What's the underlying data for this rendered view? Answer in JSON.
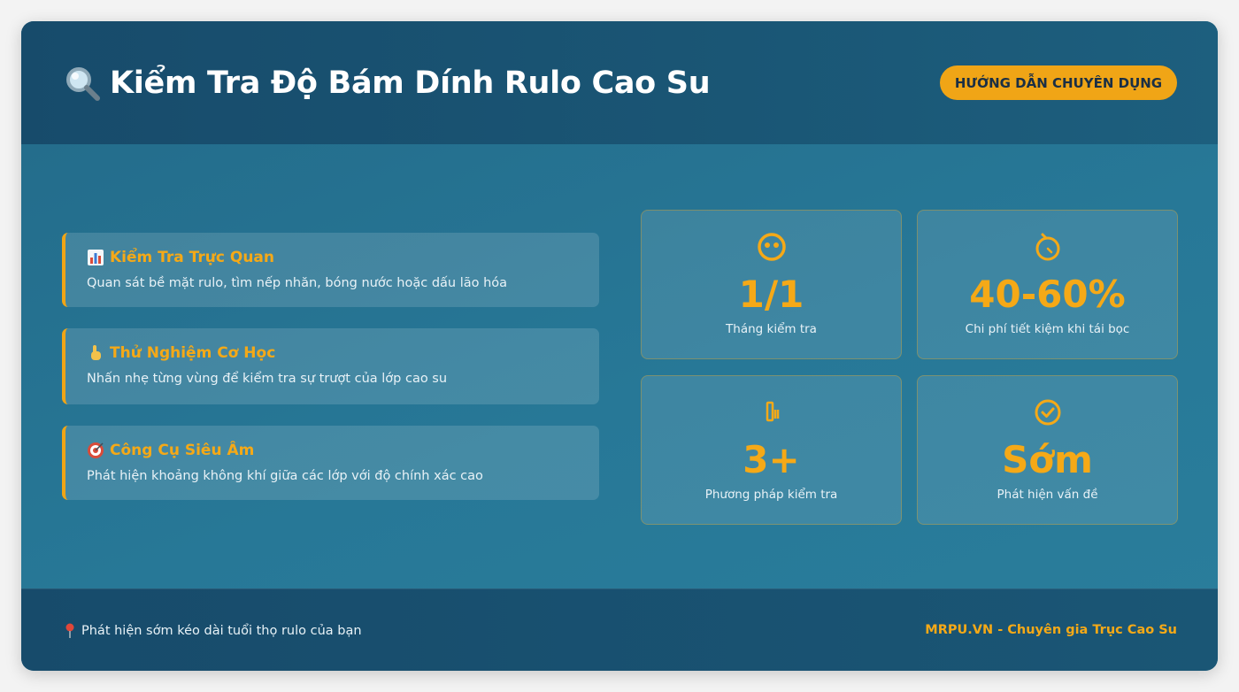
{
  "header": {
    "title": "Kiểm Tra Độ Bám Dính Rulo Cao Su",
    "title_icon": "magnifier-icon",
    "badge": "HƯỚNG DẪN CHUYÊN DỤNG"
  },
  "methods": [
    {
      "icon": "bar-chart-icon",
      "title": "Kiểm Tra Trực Quan",
      "desc": "Quan sát bề mặt rulo, tìm nếp nhăn, bóng nước hoặc dấu lão hóa"
    },
    {
      "icon": "pointing-hand-icon",
      "title": "Thử Nghiệm Cơ Học",
      "desc": "Nhấn nhẹ từng vùng để kiểm tra sự trượt của lớp cao su"
    },
    {
      "icon": "target-icon",
      "title": "Công Cụ Siêu Âm",
      "desc": "Phát hiện khoảng không khí giữa các lớp với độ chính xác cao"
    }
  ],
  "stats": [
    {
      "icon": "face-icon",
      "value": "1/1",
      "label": "Tháng kiểm tra"
    },
    {
      "icon": "stopwatch-icon",
      "value": "40-60%",
      "label": "Chi phí tiết kiệm khi tái bọc"
    },
    {
      "icon": "tool-icon",
      "value": "3+",
      "label": "Phương pháp kiểm tra"
    },
    {
      "icon": "check-circle-icon",
      "value": "Sớm",
      "label": "Phát hiện vấn đề"
    }
  ],
  "footer": {
    "pin_icon": "pin-icon",
    "left": "Phát hiện sớm kéo dài tuổi thọ rulo của bạn",
    "right": "MRPU.VN - Chuyên gia Trục Cao Su"
  },
  "colors": {
    "accent": "#f0a516",
    "header_bg": "#174b6b",
    "body_bg": "#277897",
    "text_light": "#e8f2f7"
  }
}
